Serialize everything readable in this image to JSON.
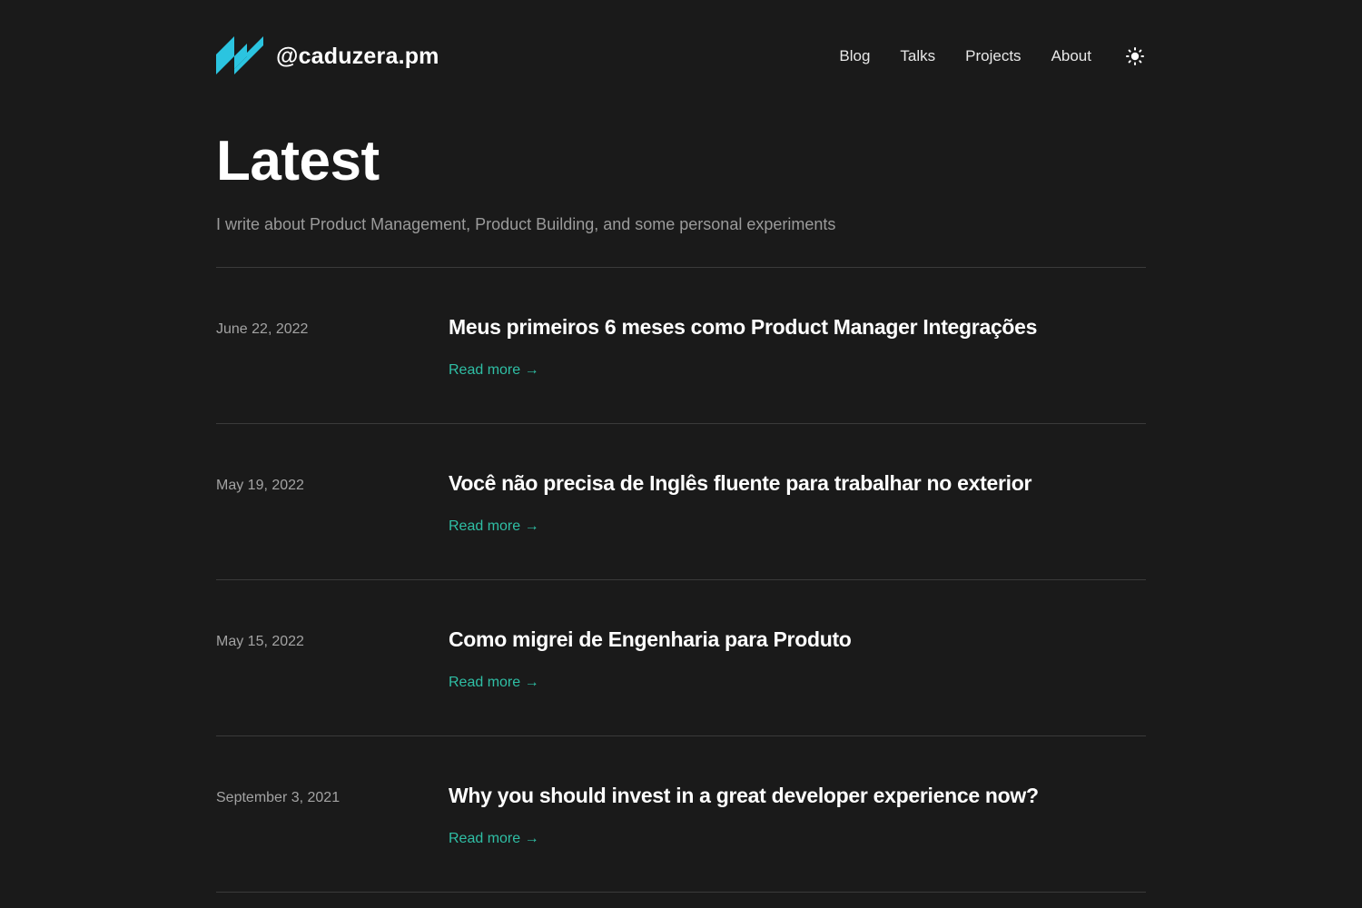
{
  "site": {
    "name": "@caduzera.pm",
    "logo_color": "#2bc4e0"
  },
  "nav": {
    "items": [
      "Blog",
      "Talks",
      "Projects",
      "About"
    ],
    "theme_toggle_icon": "sun-icon"
  },
  "hero": {
    "title": "Latest",
    "subtitle": "I write about Product Management, Product Building, and some personal experiments"
  },
  "posts": [
    {
      "date": "June 22, 2022",
      "title": "Meus primeiros 6 meses como Product Manager Integrações",
      "read_more": "Read more →"
    },
    {
      "date": "May 19, 2022",
      "title": "Você não precisa de Inglês fluente para trabalhar no exterior",
      "read_more": "Read more →"
    },
    {
      "date": "May 15, 2022",
      "title": "Como migrei de Engenharia para Produto",
      "read_more": "Read more →"
    },
    {
      "date": "September 3, 2021",
      "title": "Why you should invest in a great developer experience now?",
      "read_more": "Read more →"
    }
  ],
  "colors": {
    "background": "#1a1a1a",
    "accent": "#2fbfa5",
    "muted_text": "#9b9b9b",
    "divider": "#3a3a3a"
  }
}
